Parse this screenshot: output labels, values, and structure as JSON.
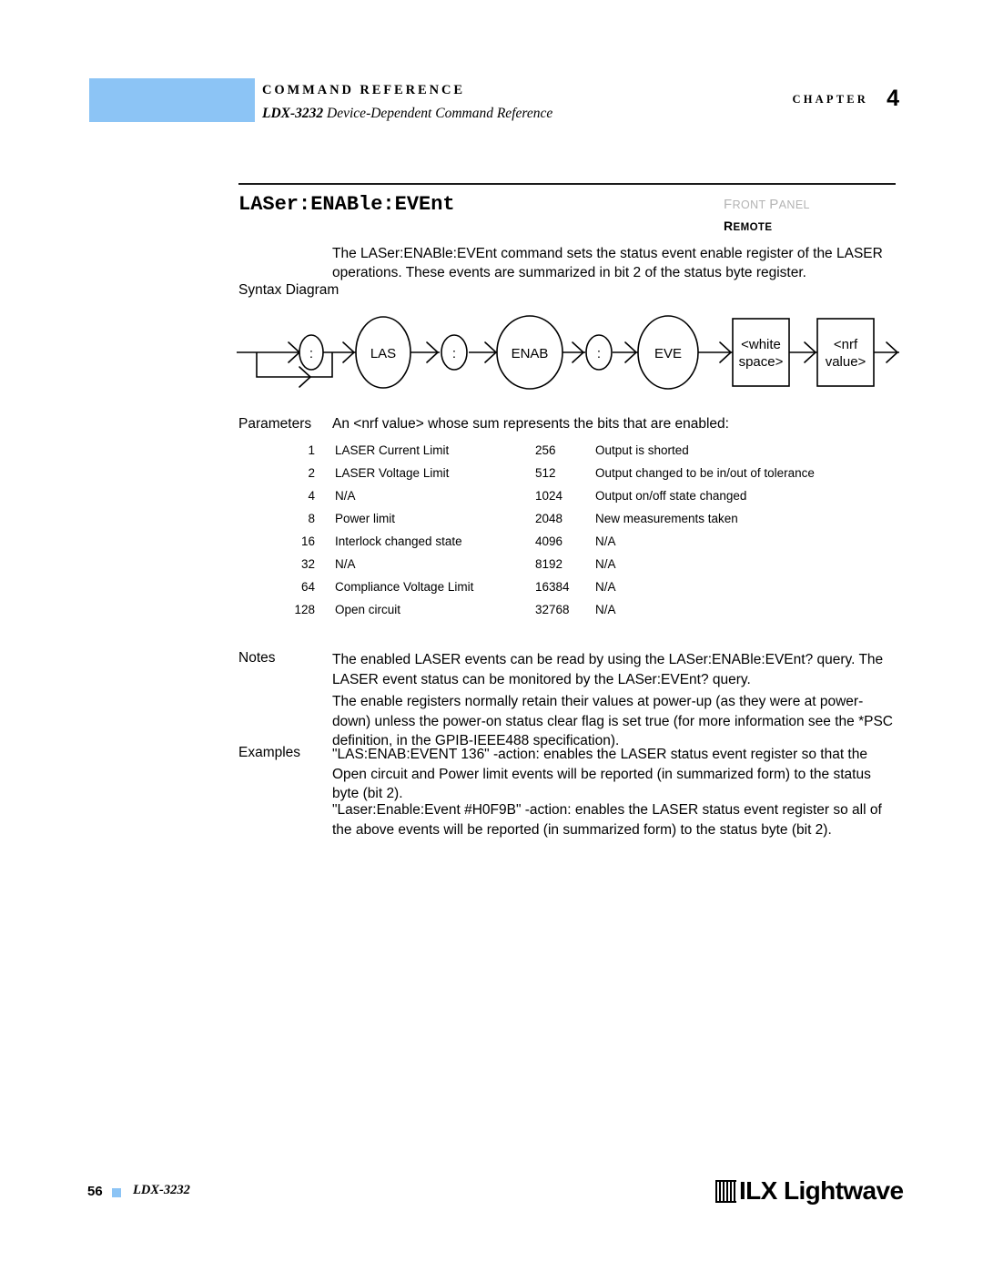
{
  "header": {
    "chapter_word": "CHAPTER",
    "chapter_number": "4",
    "title": "COMMAND REFERENCE",
    "subtitle_model": "LDX-3232",
    "subtitle_rest": "Device-Dependent Command Reference"
  },
  "section": {
    "command_title": "LASer:ENABle:EVEnt",
    "front_panel_tag": "FRONT PANEL",
    "remote_tag": "REMOTE",
    "intro": "The LASer:ENABle:EVEnt command sets the status event enable register of the LASER operations. These events are summarized in bit 2 of the status byte register."
  },
  "labels": {
    "syntax_diagram": "Syntax Diagram",
    "parameters": "Parameters",
    "notes": "Notes",
    "examples": "Examples"
  },
  "syntax_diagram": {
    "nodes": [
      {
        "shape": "ellipse",
        "label": ":"
      },
      {
        "shape": "ellipse",
        "label": "LAS"
      },
      {
        "shape": "ellipse",
        "label": ":"
      },
      {
        "shape": "ellipse",
        "label": "ENAB"
      },
      {
        "shape": "ellipse",
        "label": ":"
      },
      {
        "shape": "ellipse",
        "label": "EVE"
      },
      {
        "shape": "rect",
        "label_line1": "<white",
        "label_line2": "space>"
      },
      {
        "shape": "rect",
        "label_line1": "<nrf",
        "label_line2": "value>"
      }
    ]
  },
  "parameters": {
    "intro": "An <nrf value> whose sum represents the bits that are enabled:",
    "rows": [
      {
        "bit_a": "1",
        "desc_a": "LASER Current Limit",
        "bit_b": "256",
        "desc_b": "Output is shorted"
      },
      {
        "bit_a": "2",
        "desc_a": "LASER Voltage Limit",
        "bit_b": "512",
        "desc_b": "Output changed to be in/out of tolerance"
      },
      {
        "bit_a": "4",
        "desc_a": "N/A",
        "bit_b": "1024",
        "desc_b": "Output on/off state changed"
      },
      {
        "bit_a": "8",
        "desc_a": "Power limit",
        "bit_b": "2048",
        "desc_b": "New measurements taken"
      },
      {
        "bit_a": "16",
        "desc_a": "Interlock changed state",
        "bit_b": "4096",
        "desc_b": "N/A"
      },
      {
        "bit_a": "32",
        "desc_a": "N/A",
        "bit_b": "8192",
        "desc_b": "N/A"
      },
      {
        "bit_a": "64",
        "desc_a": "Compliance Voltage Limit",
        "bit_b": "16384",
        "desc_b": "N/A"
      },
      {
        "bit_a": "128",
        "desc_a": "Open circuit",
        "bit_b": "32768",
        "desc_b": "N/A"
      }
    ]
  },
  "notes": {
    "paragraph1": "The enabled LASER events can be read by using the LASer:ENABle:EVEnt? query. The LASER event status can be monitored by the LASer:EVEnt? query.",
    "paragraph2": "The enable registers normally retain their values at power-up (as they were at power-down) unless the power-on status clear flag is set true (for more information see the *PSC definition, in the GPIB-IEEE488 specification)."
  },
  "examples": {
    "paragraph1": "\"LAS:ENAB:EVENT 136\"  -action: enables the LASER status event register so that the Open circuit and Power limit events will be reported (in summarized form) to the status byte (bit 2).",
    "paragraph2": "\"Laser:Enable:Event #H0F9B\"  -action: enables the LASER status event register so all of the above events will be reported (in summarized form) to the status byte (bit 2)."
  },
  "footer": {
    "page_number": "56",
    "model": "LDX-3232",
    "logo_text": "ILX Lightwave"
  },
  "colors": {
    "chapter_badge": "#8CC4F5",
    "front_panel_tag": "#b3b3b3",
    "rule": "#1a1a1a"
  }
}
